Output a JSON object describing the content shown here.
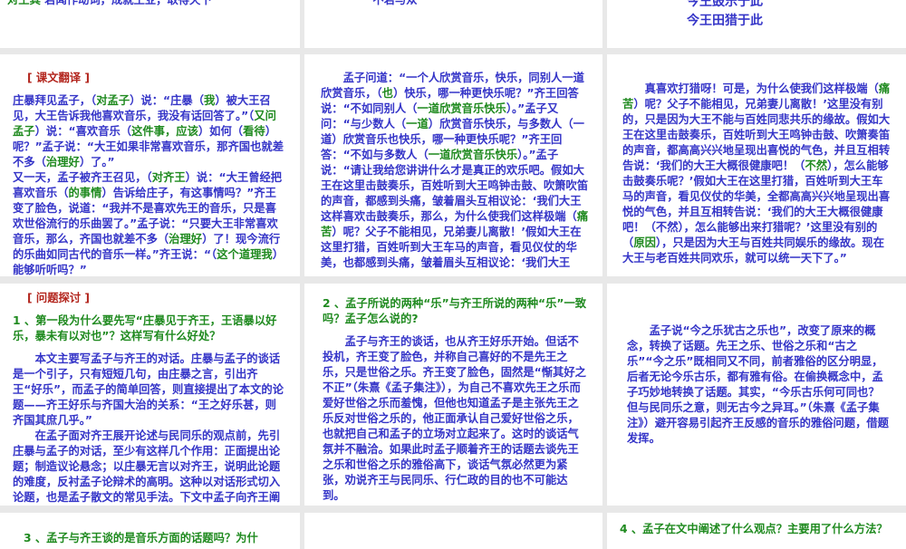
{
  "colors": {
    "blue": "#3535c8",
    "green": "#1f8a1f",
    "red": "#b3261e",
    "background": "#e8e8e8"
  },
  "slides": [
    {
      "id": "top-left",
      "paragraphs": [
        [
          [
            "对王其",
            "g"
          ],
          [
            "        若闻作动词，成就王业，取得天下",
            "b"
          ]
        ]
      ]
    },
    {
      "id": "top-middle",
      "paragraphs": [
        [
          [
            "不若与众",
            "b"
          ]
        ]
      ]
    },
    {
      "id": "top-right",
      "paragraphs": [
        [
          [
            "今王鼓乐于此",
            "b"
          ]
        ],
        [
          [
            "今王田猎于此",
            "b"
          ]
        ]
      ]
    },
    {
      "id": "translation-1",
      "paragraphs": [
        [
          [
            "[ 课文翻译 ]",
            "red"
          ]
        ],
        [
          [
            "庄暴拜见孟子，（",
            "b"
          ],
          [
            "对孟子",
            "g"
          ],
          [
            "）说：“庄暴（",
            "b"
          ],
          [
            "我",
            "g"
          ],
          [
            "）被大王召见，大王告诉我他喜欢音乐，我没有话回答了。”（",
            "b"
          ],
          [
            "又问孟子",
            "g"
          ],
          [
            "）说：“喜欢音乐（",
            "b"
          ],
          [
            "这件事，应该",
            "g"
          ],
          [
            "）如何（",
            "b"
          ],
          [
            "看待",
            "g"
          ],
          [
            "）呢？”孟子说：“大王如果非常喜欢音乐，那齐国也就差不多（",
            "b"
          ],
          [
            "治理好",
            "g"
          ],
          [
            "）了。”",
            "b"
          ]
        ],
        [
          [
            "又一天，孟子被齐王召见，（",
            "b"
          ],
          [
            "对齐王",
            "g"
          ],
          [
            "）说：“大王曾经把喜欢音乐（",
            "b"
          ],
          [
            "的事情",
            "g"
          ],
          [
            "）告诉给庄子，有这事情吗？”齐王变了脸色，说道：“我并不是喜欢先王的音乐，只是喜欢世俗流行的乐曲罢了。”孟子说：“只要大王非常喜欢音乐，那么，齐国也就差不多（",
            "b"
          ],
          [
            "治理好",
            "g"
          ],
          [
            "）了！现今流行的乐曲如同古代的音乐一样。”齐王说：“（",
            "b"
          ],
          [
            "这个道理我",
            "g"
          ],
          [
            "）能够听听吗？”",
            "b"
          ]
        ]
      ]
    },
    {
      "id": "translation-2",
      "paragraphs": [
        [
          [
            "孟子问道：“一个人欣赏音乐，快乐，同别人一道欣赏音乐，（",
            "b"
          ],
          [
            "也",
            "g"
          ],
          [
            "）快乐，哪一种更快乐呢？”齐王回答说：“不如同别人（",
            "b"
          ],
          [
            "一道欣赏音乐快乐",
            "g"
          ],
          [
            "）。”孟子又问：“与少数人（",
            "b"
          ],
          [
            "一道",
            "g"
          ],
          [
            "）欣赏音乐快乐，与多数人（一道）欣赏音乐也快乐，哪一种更快乐呢？”齐王回答：“不如与多数人（",
            "b"
          ],
          [
            "一道欣赏音乐快乐",
            "g"
          ],
          [
            "）。”孟子说：“请让我给您讲讲什么才是真正的欢乐吧。假如大王在这里击鼓奏乐，百姓听到大王鸣钟击鼓、吹箫吹笛的声音，都感到头痛，皱着眉头互相议论：‘我们大王这样喜欢击鼓奏乐，那么，为什么使我们这样极端（",
            "b"
          ],
          [
            "痛苦",
            "g"
          ],
          [
            "）呢？父子不能相见，兄弟妻儿离散！’假如大王在这里打猎，百姓听到大王车马的声音，看见仪仗的华美，也都感到头痛，皱着眉头互相议论：‘我们大王",
            "b"
          ]
        ]
      ]
    },
    {
      "id": "translation-3",
      "paragraphs": [
        [
          [
            "真喜欢打猎呀！可是，为什么使我们这样极端（",
            "b"
          ],
          [
            "痛苦",
            "g"
          ],
          [
            "）呢？父子不能相见，兄弟妻儿离散！’这里没有别的，只是因为大王不能与百姓同悲共乐的缘故。假如大王在这里击鼓奏乐，百姓听到大王鸣钟击鼓、吹箫奏笛的声音，都高高兴兴地呈现出喜悦的气色，并且互相转告说：‘我们的大王大概很健康吧！（",
            "b"
          ],
          [
            "不然",
            "g"
          ],
          [
            "），怎么能够击鼓奏乐呢？’假如大王在这里打猎，百姓听到大王车马的声音，看见仪仗的华美，全都高高兴兴地呈现出喜悦的气色，并且互相转告说：‘我们的大王大概很健康吧！（不然），怎么能够出来打猎呢？’这里没有别的（",
            "b"
          ],
          [
            "原因",
            "g"
          ],
          [
            "），只是因为大王与百姓共同娱乐的缘故。现在大王与老百姓共同欢乐，就可以统一天下了。”",
            "b"
          ]
        ]
      ]
    },
    {
      "id": "question-1",
      "paragraphs": [
        [
          [
            "[ 问题探讨 ]",
            "red"
          ]
        ],
        [
          [
            "1 、第一段为什么要先写“庄暴见于齐王，王语暴以好乐，暴未有以对也”？这样写有什么好处？",
            "g"
          ]
        ],
        [
          [
            "本文主要写孟子与齐王的对话。庄暴与孟子的谈话是一个引子，只有短短几句，由庄暴之言，引出齐王“好乐”，而孟子的简单回答，则直接提出了本文的论题——齐王好乐与齐国大治的关系：“王之好乐甚，则齐国其庶几乎。”",
            "b"
          ]
        ],
        [
          [
            "在孟子面对齐王展开论述与民同乐的观点前，先引庄暴与孟子的对话，至少有这样几个作用：正面提出论题；制造议论悬念；以庄暴无言以对齐王，说明此论题的难度，反衬孟子论辩术的高明。这种以对话形式切入论题，也是孟子散文的常见手法。下文中孟子向齐王阐述自己的观点，仍是用对话方式切入。",
            "b"
          ]
        ]
      ]
    },
    {
      "id": "question-2",
      "paragraphs": [
        [
          [
            "2 、孟子所说的两种“乐”与齐王所说的两种“乐”一致吗？孟子怎么说的?",
            "g"
          ]
        ],
        [
          [
            "孟子与齐王的谈话，也从齐王好乐开始。但话不投机，齐王变了脸色，并称自己喜好的不是先王之乐，只是世俗之乐。齐王变了脸色，固然是“惭其好之不正”（朱熹《孟子集注》），为自己不喜欢先王之乐而爱好世俗之乐而羞愧，但他也知道孟子是主张先王之乐反对世俗之乐的，他正面承认自己爱好世俗之乐，也就把自己和孟子的立场对立起来了。这时的谈话气氛并不融洽。如果此时孟子顺着齐王的话题去谈先王之乐和世俗之乐的雅俗高下，谈话气氛必然更为紧张，劝说齐王与民同乐、行仁政的目的也不可能达到。",
            "b"
          ]
        ]
      ]
    },
    {
      "id": "question-2-cont",
      "paragraphs": [
        [
          [
            "孟子说“今之乐犹古之乐也”，改变了原来的概念，转换了话题。先王之乐、世俗之乐和“古之乐”“今之乐”既相同又不同，前者雅俗的区分明显，后者无论今乐古乐，都有雅有俗。在偷换概念中，孟子巧妙地转换了话题。其实，“今乐古乐何可同也？但与民同乐之意，则无古今之异耳。”（朱熹《孟子集注》）避开容易引起齐王反感的音乐的雅俗问题，借题发挥。",
            "b"
          ]
        ]
      ]
    },
    {
      "id": "question-3",
      "paragraphs": [
        [
          [
            "3 、孟子与齐王谈的是音乐方面的话题吗？为什",
            "g"
          ]
        ]
      ]
    },
    {
      "id": "blank",
      "paragraphs": []
    },
    {
      "id": "question-4",
      "paragraphs": [
        [
          [
            "4 、孟子在文中阐述了什么观点？主要用了什么方法？",
            "g"
          ]
        ]
      ]
    }
  ]
}
